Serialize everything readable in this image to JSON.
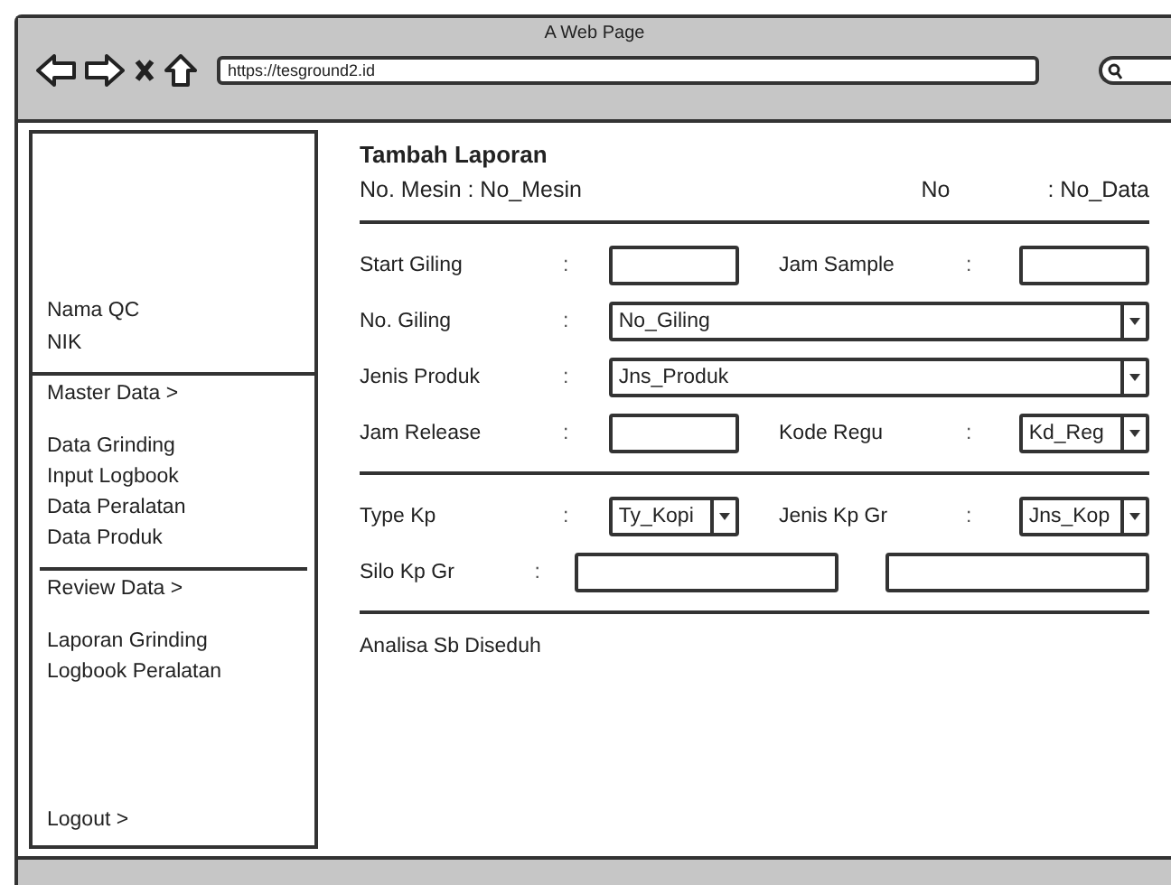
{
  "window": {
    "title": "A Web Page",
    "url": "https://tesground2.id"
  },
  "sidebar": {
    "user": [
      "Nama QC",
      "NIK"
    ],
    "groups": [
      {
        "heading": "Master Data >",
        "items": [
          "Data Grinding",
          "Input Logbook",
          "Data Peralatan",
          "Data Produk"
        ]
      },
      {
        "heading": "Review Data >",
        "items": [
          "Laporan Grinding",
          "Logbook Peralatan"
        ]
      }
    ],
    "logout": "Logout >"
  },
  "form": {
    "title": "Tambah Laporan",
    "machine_label": "No. Mesin : No_Mesin",
    "number_label": "No",
    "number_value": ": No_Data",
    "sections": [
      {
        "rows": [
          {
            "label": "Start Giling",
            "separator": ":",
            "control": {
              "kind": "text"
            },
            "label2": "Jam Sample",
            "separator2": ":",
            "control2": {
              "kind": "text"
            }
          },
          {
            "label": "No. Giling",
            "separator": ":",
            "control": {
              "kind": "select",
              "value": "No_Giling"
            }
          },
          {
            "label": "Jenis Produk",
            "separator": ":",
            "control": {
              "kind": "select",
              "value": "Jns_Produk"
            }
          },
          {
            "label": "Jam Release",
            "separator": ":",
            "control": {
              "kind": "text"
            },
            "label2": "Kode Regu",
            "separator2": ":",
            "control2": {
              "kind": "select",
              "value": "Kd_Reg"
            }
          }
        ]
      },
      {
        "rows": [
          {
            "label": "Type Kp",
            "separator": ":",
            "control": {
              "kind": "select",
              "value": "Ty_Kopi"
            },
            "label2": "Jenis Kp Gr",
            "separator2": ":",
            "control2": {
              "kind": "select",
              "value": "Jns_Kop"
            }
          },
          {
            "label": "Silo Kp Gr",
            "separator": ":",
            "control": {
              "kind": "text"
            },
            "control2": {
              "kind": "text"
            }
          }
        ]
      }
    ],
    "footer": "Analisa Sb Diseduh"
  }
}
